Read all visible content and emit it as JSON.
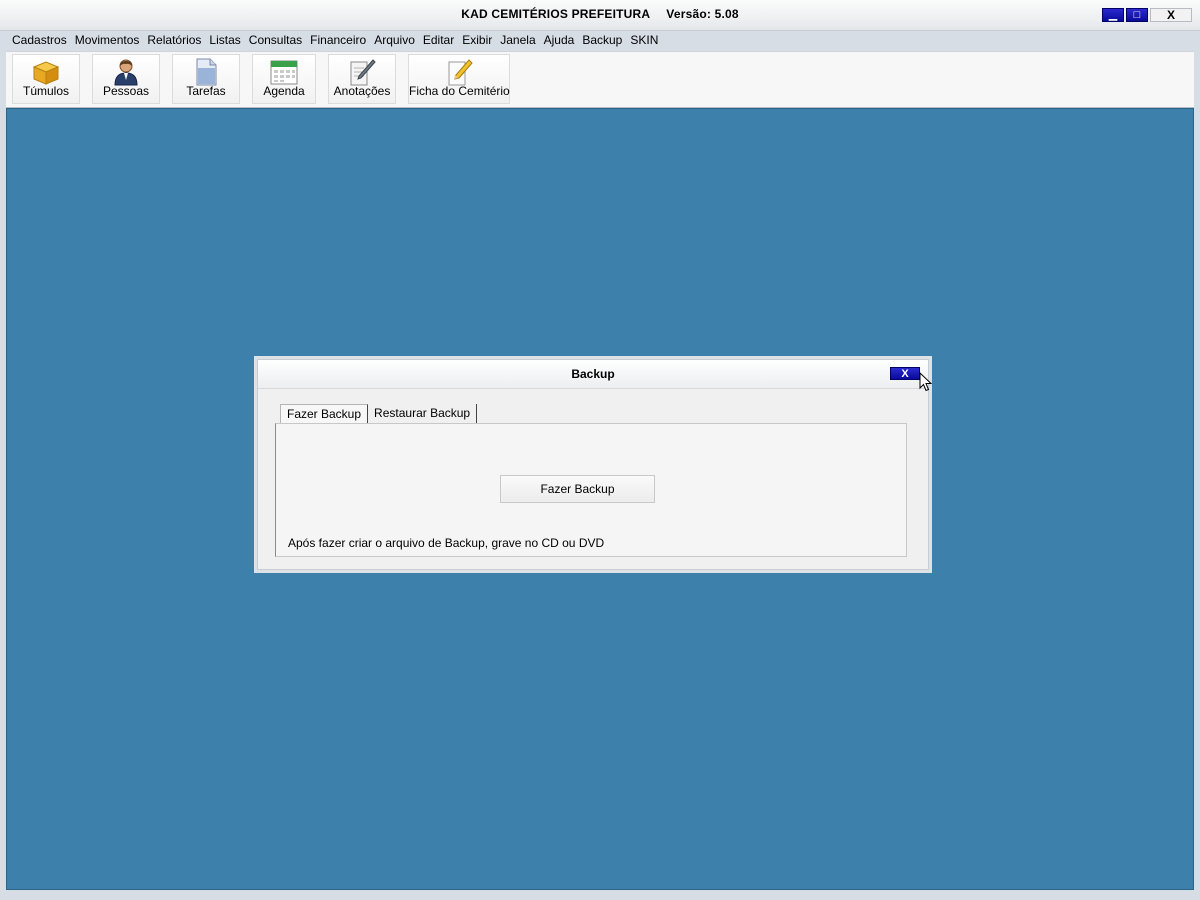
{
  "app": {
    "title": "KAD CEMITÉRIOS PREFEITURA",
    "version": "Versão: 5.08"
  },
  "window_buttons": {
    "minimize": "▁",
    "maximize": "□",
    "close": "X"
  },
  "menu": [
    {
      "label": "Cadastros"
    },
    {
      "label": "Movimentos"
    },
    {
      "label": "Relatórios"
    },
    {
      "label": "Listas"
    },
    {
      "label": "Consultas"
    },
    {
      "label": "Financeiro"
    },
    {
      "label": "Arquivo"
    },
    {
      "label": "Editar"
    },
    {
      "label": "Exibir"
    },
    {
      "label": "Janela"
    },
    {
      "label": "Ajuda"
    },
    {
      "label": "Backup"
    },
    {
      "label": "SKIN"
    }
  ],
  "toolbar": [
    {
      "label": "Túmulos",
      "icon": "box-icon"
    },
    {
      "label": "Pessoas",
      "icon": "person-icon"
    },
    {
      "label": "Tarefas",
      "icon": "document-icon"
    },
    {
      "label": "Agenda",
      "icon": "calendar-icon"
    },
    {
      "label": "Anotações",
      "icon": "notepad-pen-icon"
    },
    {
      "label": "Ficha do Cemitério",
      "icon": "pencil-icon"
    }
  ],
  "dialog": {
    "title": "Backup",
    "close": "X",
    "tabs": [
      {
        "label": "Fazer Backup",
        "active": true
      },
      {
        "label": "Restaurar Backup",
        "active": false
      }
    ],
    "button_label": "Fazer Backup",
    "hint": "Após fazer criar o arquivo de Backup, grave no CD ou DVD"
  },
  "colors": {
    "workspace": "#3e80ac",
    "title_button": "#0a0a9c"
  }
}
